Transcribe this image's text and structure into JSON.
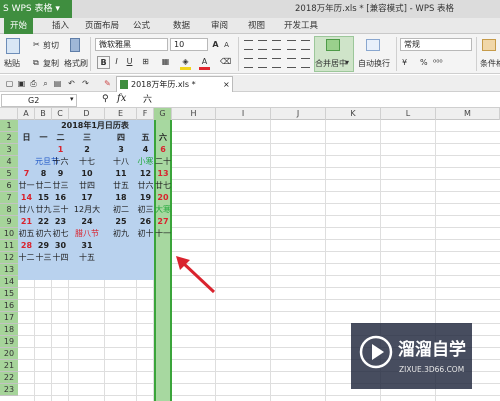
{
  "app": {
    "name": "WPS 表格",
    "doc_title": "2018万年历.xls * [兼容模式] - WPS 表格"
  },
  "menu_tabs": [
    "开始",
    "插入",
    "页面布局",
    "公式",
    "数据",
    "审阅",
    "视图",
    "开发工具"
  ],
  "ribbon": {
    "paste": "粘贴",
    "cut": "剪切",
    "copy": "复制",
    "format_painter": "格式刷",
    "font_name": "微软雅黑",
    "font_size": "10",
    "bold": "B",
    "italic": "I",
    "underline": "U",
    "merge_center": "合并居中",
    "wrap_text": "自动换行",
    "number_format": "常规",
    "percent": "%",
    "conditional": "条件格"
  },
  "doc_tab": "2018万年历.xls *",
  "formula_bar": {
    "name_box": "G2",
    "fx": "fx",
    "value": "六"
  },
  "columns": [
    "A",
    "B",
    "C",
    "D",
    "E",
    "F",
    "G",
    "H",
    "I",
    "J",
    "K",
    "L",
    "M"
  ],
  "rows": [
    "1",
    "2",
    "3",
    "4",
    "5",
    "6",
    "7",
    "8",
    "9",
    "10",
    "11",
    "12",
    "13",
    "14",
    "15",
    "16",
    "17",
    "18",
    "19",
    "20",
    "21",
    "22",
    "23"
  ],
  "calendar": {
    "title": "2018年1月日历表",
    "weekdays": [
      "日",
      "一",
      "二",
      "三",
      "四",
      "五",
      "六"
    ],
    "grid": [
      [
        [
          "",
          ""
        ],
        [
          "",
          ""
        ],
        [
          "1",
          "red"
        ],
        [
          "2",
          "blk"
        ],
        [
          "3",
          "blk"
        ],
        [
          "4",
          "blk"
        ],
        [
          "6",
          "red"
        ]
      ],
      [
        [
          "",
          ""
        ],
        [
          "元旦节",
          "blue"
        ],
        [
          "十六",
          ""
        ],
        [
          "十七",
          ""
        ],
        [
          "十八",
          ""
        ],
        [
          "小寒",
          "grn"
        ],
        [
          "二十",
          ""
        ]
      ],
      [
        [
          "7",
          "red"
        ],
        [
          "8",
          "blk"
        ],
        [
          "9",
          "blk"
        ],
        [
          "10",
          "blk"
        ],
        [
          "11",
          "blk"
        ],
        [
          "12",
          "blk"
        ],
        [
          "13",
          "red"
        ]
      ],
      [
        [
          "廿一",
          ""
        ],
        [
          "廿二",
          ""
        ],
        [
          "廿三",
          ""
        ],
        [
          "廿四",
          ""
        ],
        [
          "廿五",
          ""
        ],
        [
          "廿六",
          ""
        ],
        [
          "廿七",
          ""
        ]
      ],
      [
        [
          "14",
          "red"
        ],
        [
          "15",
          "blk"
        ],
        [
          "16",
          "blk"
        ],
        [
          "17",
          "blk"
        ],
        [
          "18",
          "blk"
        ],
        [
          "19",
          "blk"
        ],
        [
          "20",
          "red"
        ]
      ],
      [
        [
          "廿八",
          ""
        ],
        [
          "廿九",
          ""
        ],
        [
          "三十",
          ""
        ],
        [
          "12月大",
          ""
        ],
        [
          "初二",
          ""
        ],
        [
          "初三",
          ""
        ],
        [
          "大寒",
          "grn"
        ]
      ],
      [
        [
          "21",
          "red"
        ],
        [
          "22",
          "blk"
        ],
        [
          "23",
          "blk"
        ],
        [
          "24",
          "blk"
        ],
        [
          "25",
          "blk"
        ],
        [
          "26",
          "blk"
        ],
        [
          "27",
          "red"
        ]
      ],
      [
        [
          "初五",
          ""
        ],
        [
          "初六",
          ""
        ],
        [
          "初七",
          ""
        ],
        [
          "腊八节",
          "redl"
        ],
        [
          "初九",
          ""
        ],
        [
          "初十",
          ""
        ],
        [
          "十一",
          ""
        ]
      ],
      [
        [
          "28",
          "red"
        ],
        [
          "29",
          "blk"
        ],
        [
          "30",
          "blk"
        ],
        [
          "31",
          "blk"
        ],
        [
          "",
          ""
        ],
        [
          "",
          ""
        ],
        [
          "",
          ""
        ]
      ],
      [
        [
          "十二",
          ""
        ],
        [
          "十三",
          ""
        ],
        [
          "十四",
          ""
        ],
        [
          "十五",
          ""
        ],
        [
          "",
          ""
        ],
        [
          "",
          ""
        ],
        [
          "",
          ""
        ]
      ]
    ]
  },
  "colors": {
    "wps_green": "#3f8e3f",
    "calendar_fill": "#b7d1ee",
    "selected_col": "#a7d8a0",
    "selected_border": "#3aa43a",
    "arrow": "#d9232e"
  },
  "watermark": {
    "brand": "溜溜自学",
    "url": "ZIXUE.3D66.COM"
  }
}
